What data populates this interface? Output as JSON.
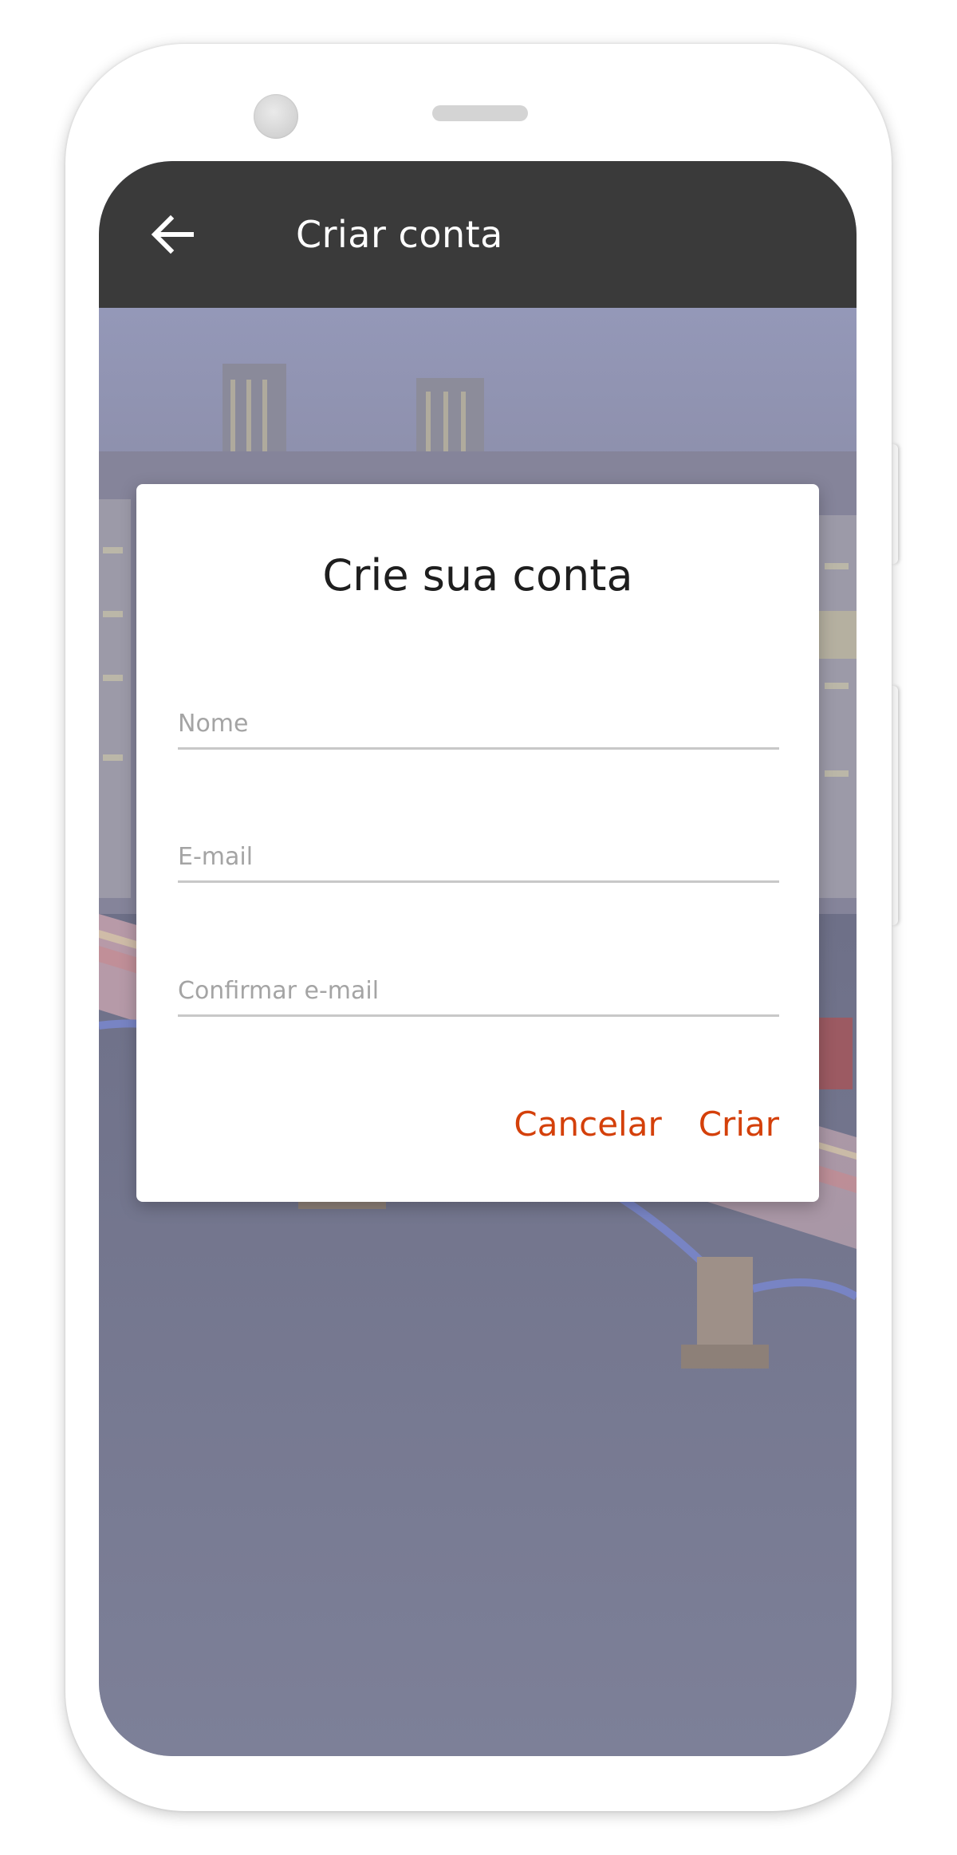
{
  "app_bar": {
    "title": "Criar conta",
    "back_icon": "arrow-left-icon"
  },
  "dialog": {
    "title": "Crie sua conta",
    "fields": [
      {
        "placeholder": "Nome",
        "value": ""
      },
      {
        "placeholder": "E-mail",
        "value": ""
      },
      {
        "placeholder": "Confirmar e-mail",
        "value": ""
      }
    ],
    "cancel_label": "Cancelar",
    "create_label": "Criar"
  },
  "colors": {
    "app_bar": "#3a3a3a",
    "accent": "#d4400a",
    "background_tint": "#8d90a8"
  }
}
